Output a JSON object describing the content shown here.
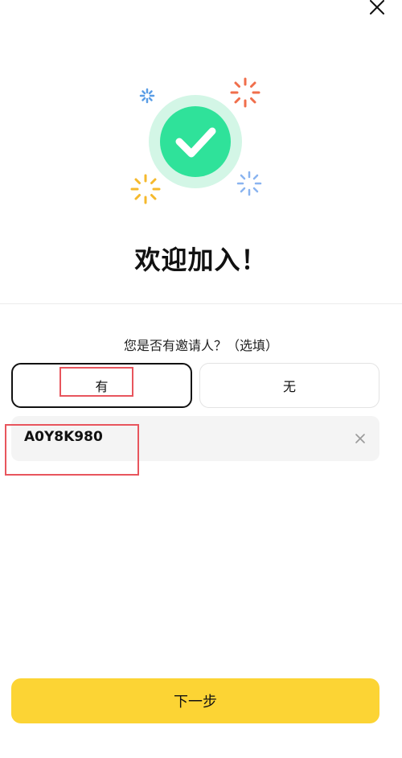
{
  "header": {
    "close_icon": "close-icon"
  },
  "hero": {
    "icon": "check-circle-icon",
    "colors": {
      "circle_outer": "#d3f6e6",
      "circle_inner": "#2fe29a",
      "spark_blue": "#5b9ee6",
      "spark_orange": "#f06e4b",
      "spark_yellow": "#f5b92d",
      "spark_lightblue": "#8ab4f0"
    }
  },
  "welcome": {
    "title": "欢迎加入！"
  },
  "invite": {
    "question": "您是否有邀请人？（选填）",
    "option_yes": "有",
    "option_no": "无",
    "selected": "有",
    "code_value": "A0Y8K980",
    "clear_icon": "clear-icon"
  },
  "footer": {
    "next_label": "下一步",
    "accent": "#fcd434"
  },
  "annotations": {
    "highlight_color": "#e8555d"
  }
}
